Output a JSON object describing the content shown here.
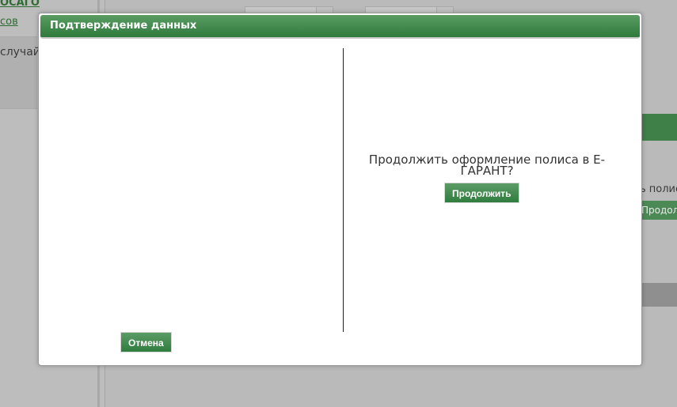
{
  "background": {
    "left_link_top": "ОСАГО",
    "left_link_second": "сов",
    "left_text": "случай",
    "right_text": "ь полис",
    "right_button": "Продолж"
  },
  "modal": {
    "title": "Подтверждение данных",
    "prompt": "Продолжить оформление полиса в Е-ГАРАНТ?",
    "continue_label": "Продолжить",
    "cancel_label": "Отмена"
  },
  "colors": {
    "header_green": "#3d8746",
    "button_green": "#3f8a4c",
    "overlay_gray": "#b9b9b9"
  }
}
